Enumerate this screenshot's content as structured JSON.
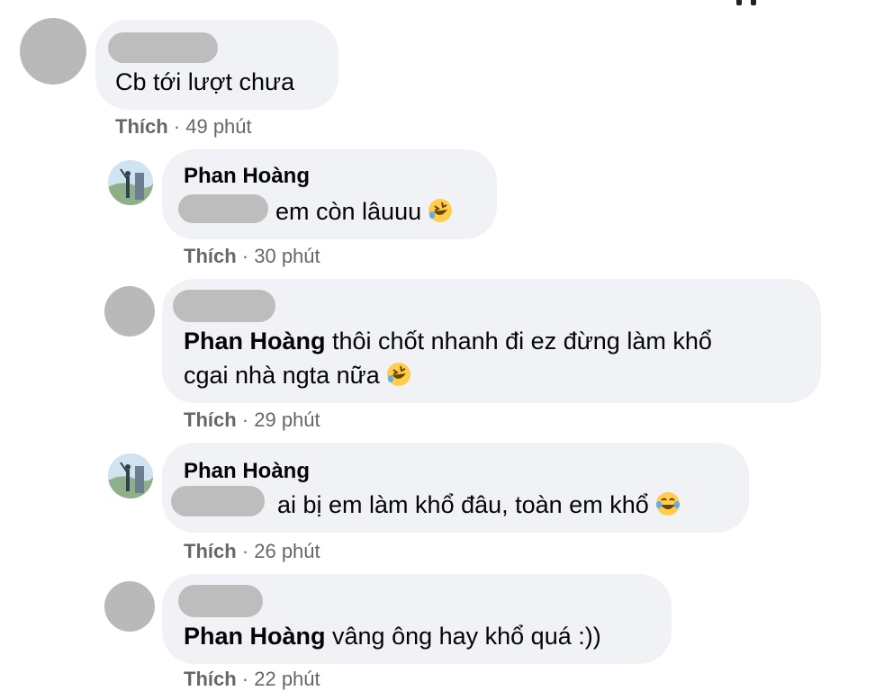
{
  "comments": [
    {
      "author": "",
      "text": "Cb tới lượt chưa",
      "like_label": "Thích",
      "time": "49 phút"
    },
    {
      "author": "Phan Hoàng",
      "text": "em còn lâuuu",
      "emoji": "rofl-emoji-icon",
      "like_label": "Thích",
      "time": "30 phút"
    },
    {
      "author": "",
      "mention": "Phan Hoàng",
      "text_line1": " thôi chốt nhanh đi ez đừng làm khổ",
      "text_line2": "cgai nhà ngta nữa",
      "emoji": "rofl-emoji-icon",
      "like_label": "Thích",
      "time": "29 phút"
    },
    {
      "author": "Phan Hoàng",
      "text": "ai bị em làm khổ đâu, toàn em khổ",
      "emoji": "joy-emoji-icon",
      "like_label": "Thích",
      "time": "26 phút"
    },
    {
      "author": "",
      "mention": "Phan Hoàng",
      "text": " vâng ông hay khổ quá :))",
      "like_label": "Thích",
      "time": "22 phút"
    }
  ],
  "separator": " · ",
  "colors": {
    "bubble_bg": "#f0f2f5",
    "meta_text": "#65676b",
    "redacted": "#bdbdbd",
    "emoji_yellow": "#ffcc4d"
  }
}
